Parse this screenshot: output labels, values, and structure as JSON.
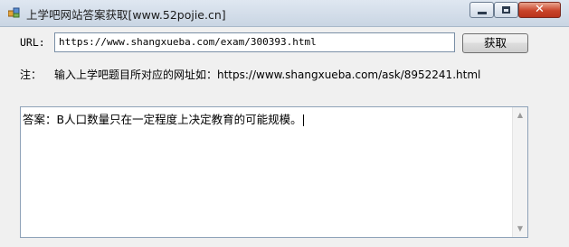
{
  "window": {
    "title": "上学吧网站答案获取[www.52pojie.cn]",
    "close_glyph": "✕"
  },
  "form": {
    "url_label": "URL:",
    "url_value": "https://www.shangxueba.com/exam/300393.html",
    "fetch_button": "获取"
  },
  "note": {
    "label": "注：",
    "text": "输入上学吧题目所对应的网址如：https://www.shangxueba.com/ask/8952241.html"
  },
  "answer": {
    "text": "答案：B人口数量只在一定程度上决定教育的可能规模。",
    "scroll_up": "▲",
    "scroll_down": "▼"
  }
}
